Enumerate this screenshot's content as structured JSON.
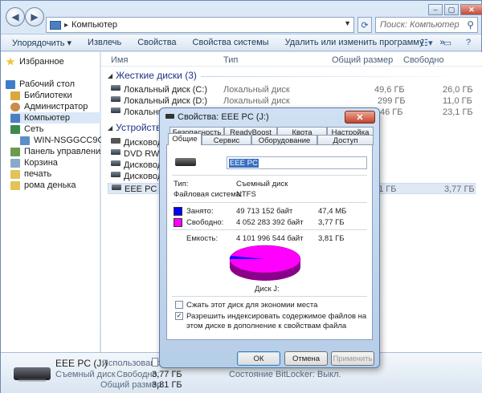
{
  "window": {
    "address": "Компьютер",
    "search_placeholder": "Поиск: Компьютер"
  },
  "toolbar": {
    "items": [
      "Упорядочить ▾",
      "Извлечь",
      "Свойства",
      "Свойства системы",
      "Удалить или изменить программу",
      "»"
    ]
  },
  "sidebar": {
    "items": [
      "Избранное",
      "Рабочий стол",
      "Библиотеки",
      "Администратор",
      "Компьютер",
      "Сеть",
      "WIN-NSGGCC9GGMU",
      "Панель управления",
      "Корзина",
      "печать",
      "рома денька"
    ]
  },
  "columns": {
    "name": "Имя",
    "type": "Тип",
    "total": "Общий размер",
    "free": "Свободно"
  },
  "groups": {
    "hdd": "Жесткие диски (3)",
    "removable": "Устройства с"
  },
  "hdd_rows": [
    {
      "name": "Локальный диск (C:)",
      "type": "Локальный диск",
      "total": "49,6 ГБ",
      "free": "26,0 ГБ"
    },
    {
      "name": "Локальный диск (D:)",
      "type": "Локальный диск",
      "total": "299 ГБ",
      "free": "11,0 ГБ"
    },
    {
      "name": "Локальный д",
      "type": "",
      "total": "46 ГБ",
      "free": "23,1 ГБ"
    }
  ],
  "removable_rows": [
    {
      "name": "Дисковод (A",
      "total": "",
      "free": ""
    },
    {
      "name": "DVD RW дис",
      "total": "",
      "free": ""
    },
    {
      "name": "Дисковод BD",
      "total": "",
      "free": ""
    },
    {
      "name": "Дисковод BD",
      "total": "",
      "free": ""
    },
    {
      "name": "EEE PC (J:)",
      "total": "81 ГБ",
      "free": "3,77 ГБ"
    }
  ],
  "details": {
    "name": "EEE PC (J:)",
    "kind": "Съемный диск",
    "used_label": "Использовано:",
    "free_label": "Свободно:",
    "free_value": "3,77 ГБ",
    "total_label": "Общий размер:",
    "total_value": "3,81 ГБ",
    "extra": "Состояние BitLocker: Выкл."
  },
  "dialog": {
    "title": "Свойства: EEE PC (J:)",
    "close": "✕",
    "tabs_row1": [
      "Безопасность",
      "ReadyBoost",
      "Квота",
      "Настройка"
    ],
    "tabs_row2": [
      "Общие",
      "Сервис",
      "Оборудование",
      "Доступ"
    ],
    "volume_name": "EEE PC",
    "type_label": "Тип:",
    "type_value": "Съемный диск",
    "fs_label": "Файловая система:",
    "fs_value": "NTFS",
    "used_label": "Занято:",
    "used_bytes": "49 713 152 байт",
    "used_size": "47,4 МБ",
    "free_label": "Свободно:",
    "free_bytes": "4 052 283 392 байт",
    "free_size": "3,77 ГБ",
    "capacity_label": "Емкость:",
    "capacity_bytes": "4 101 996 544 байт",
    "capacity_size": "3,81 ГБ",
    "disk_label": "Диск J:",
    "used_fraction": 0.0121,
    "used_color": "#0000ff",
    "free_color": "#ff00ff",
    "compress_label": "Сжать этот диск для экономии места",
    "index_label": "Разрешить индексировать содержимое файлов на этом диске в дополнение к свойствам файла",
    "ok": "ОК",
    "cancel": "Отмена",
    "apply": "Применить"
  }
}
